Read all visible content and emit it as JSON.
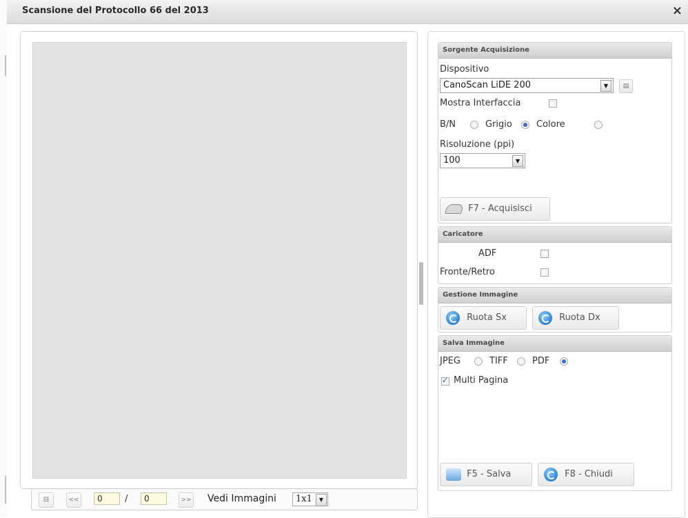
{
  "window": {
    "title": "Scansione del Protocollo 66 del 2013",
    "close_glyph": "×"
  },
  "navigator": {
    "first_glyph": "⊟",
    "prev_glyph": "<<",
    "current_page": "0",
    "slash": "/",
    "total_pages": "0",
    "next_glyph": ">>",
    "vedi_label": "Vedi Immagini",
    "layout_value": "1x1"
  },
  "source": {
    "header": "Sorgente Acquisizione",
    "device_label": "Dispositivo",
    "device_value": "CanoScan LiDE 200",
    "show_interface_label": "Mostra Interfaccia",
    "show_interface_checked": false,
    "bw_label": "B/N",
    "grey_label": "Grigio",
    "color_label": "Colore",
    "color_mode_selected": "Grigio",
    "resolution_label": "Risoluzione (ppi)",
    "resolution_value": "100",
    "acquire_button": "F7 - Acquisisci"
  },
  "loader": {
    "header": "Caricatore",
    "adf_label": "ADF",
    "adf_checked": false,
    "duplex_label": "Fronte/Retro",
    "duplex_checked": false
  },
  "image_mgmt": {
    "header": "Gestione Immagine",
    "rotate_left": "Ruota Sx",
    "rotate_right": "Ruota Dx"
  },
  "save": {
    "header": "Salva Immagine",
    "jpeg_label": "JPEG",
    "tiff_label": "TIFF",
    "pdf_label": "PDF",
    "format_selected": "PDF",
    "multipage_label": "Multi Pagina",
    "multipage_checked": true,
    "save_button": "F5 - Salva",
    "close_button": "F8 - Chiudi"
  },
  "colors": {
    "radio_on": "#3a6fd0",
    "page_input_bg": "#fffbe0",
    "preview_bg": "#e3e3e3"
  }
}
